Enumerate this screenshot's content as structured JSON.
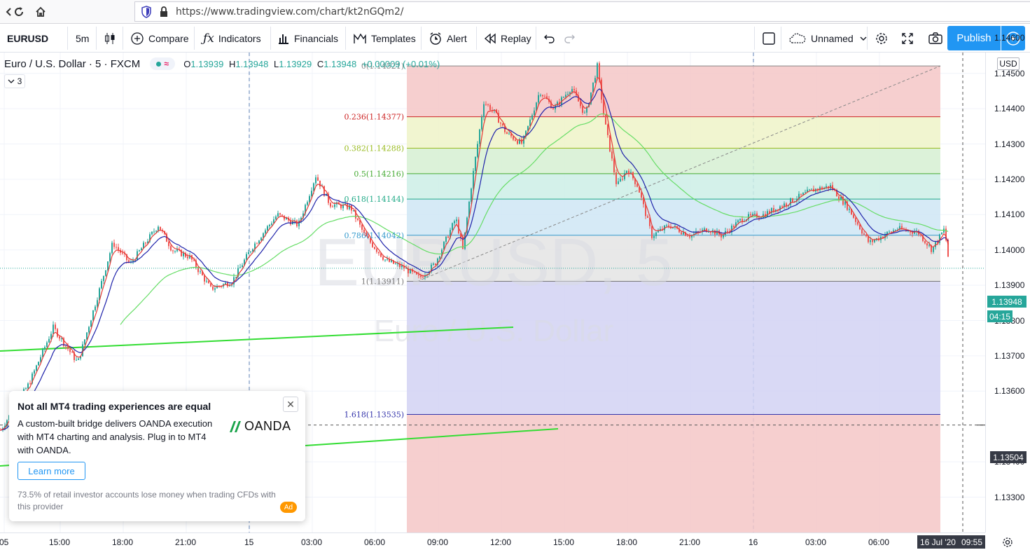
{
  "browser": {
    "url": "https://www.tradingview.com/chart/kt2nGQm2/",
    "icons": [
      "back-icon",
      "reload-icon",
      "home-icon",
      "shield-icon",
      "lock-icon"
    ]
  },
  "toolbar": {
    "symbol": "EURUSD",
    "interval": "5m",
    "compare": "Compare",
    "indicators": "Indicators",
    "financials": "Financials",
    "templates": "Templates",
    "alert": "Alert",
    "replay": "Replay",
    "layout_name": "Unnamed",
    "publish": "Publish"
  },
  "legend": {
    "title": "Euro / U.S. Dollar · 5 · FXCM",
    "status_icon": "≈",
    "o_key": "O",
    "o_val": "1.13939",
    "h_key": "H",
    "h_val": "1.13948",
    "l_key": "L",
    "l_val": "1.13929",
    "c_key": "C",
    "c_val": "1.13948",
    "change": "+0.00009 (+0.01%)",
    "collapse_count": "3"
  },
  "watermark": {
    "symbol": "EURUSD, 5",
    "description": "Euro / U.S. Dollar"
  },
  "colors": {
    "up_candle": "#26a69a",
    "down_candle": "#ef5350",
    "ma_fast": "#e53935",
    "ma_mid": "#1e22aa",
    "ma_slow": "#66dd66",
    "trend_line": "#33dd33",
    "accent": "#2196f3"
  },
  "fib": {
    "levels": [
      {
        "label": "0(1.14521)",
        "ratio": 0,
        "color": "#888888",
        "fill": "#f4c7c7"
      },
      {
        "label": "0.236(1.14377)",
        "ratio": 0.236,
        "color": "#cc2222",
        "fill": "#f4c7c7"
      },
      {
        "label": "0.382(1.14288)",
        "ratio": 0.382,
        "color": "#99bb22",
        "fill": "#eef3c8"
      },
      {
        "label": "0.5(1.14216)",
        "ratio": 0.5,
        "color": "#44aa33",
        "fill": "#d6f0d2"
      },
      {
        "label": "0.618(1.14144)",
        "ratio": 0.618,
        "color": "#22aa88",
        "fill": "#cdeee6"
      },
      {
        "label": "0.786(1.14042)",
        "ratio": 0.786,
        "color": "#3399cc",
        "fill": "#cfe6f4"
      },
      {
        "label": "1(1.13911)",
        "ratio": 1,
        "color": "#777777",
        "fill": "#e4e4e4"
      },
      {
        "label": "1.618(1.13535)",
        "ratio": 1.618,
        "color": "#3333aa",
        "fill": "#d2d2f3"
      }
    ]
  },
  "price_axis": {
    "currency": "USD",
    "ticks": [
      "1.14600",
      "1.14500",
      "1.14400",
      "1.14300",
      "1.14200",
      "1.14100",
      "1.14000",
      "1.13900",
      "1.13800",
      "1.13700",
      "1.13600",
      "1.13400",
      "1.13300"
    ],
    "last_price": "1.13948",
    "countdown": "04:15",
    "crosshair_price": "1.13504"
  },
  "time_axis": {
    "ticks": [
      "05",
      "15:00",
      "18:00",
      "21:00",
      "15",
      "03:00",
      "06:00",
      "09:00",
      "12:00",
      "15:00",
      "18:00",
      "21:00",
      "16",
      "03:00",
      "06:00"
    ],
    "crosshair_date": "16 Jul '20",
    "crosshair_time": "09:55"
  },
  "ad": {
    "title": "Not all MT4 trading experiences are equal",
    "body": "A custom-built bridge delivers OANDA execution with MT4 charting and analysis. Plug in to MT4 with OANDA.",
    "brand": "OANDA",
    "cta": "Learn more",
    "disclaimer": "73.5% of retail investor accounts lose money when trading CFDs with this provider",
    "badge": "Ad"
  }
}
